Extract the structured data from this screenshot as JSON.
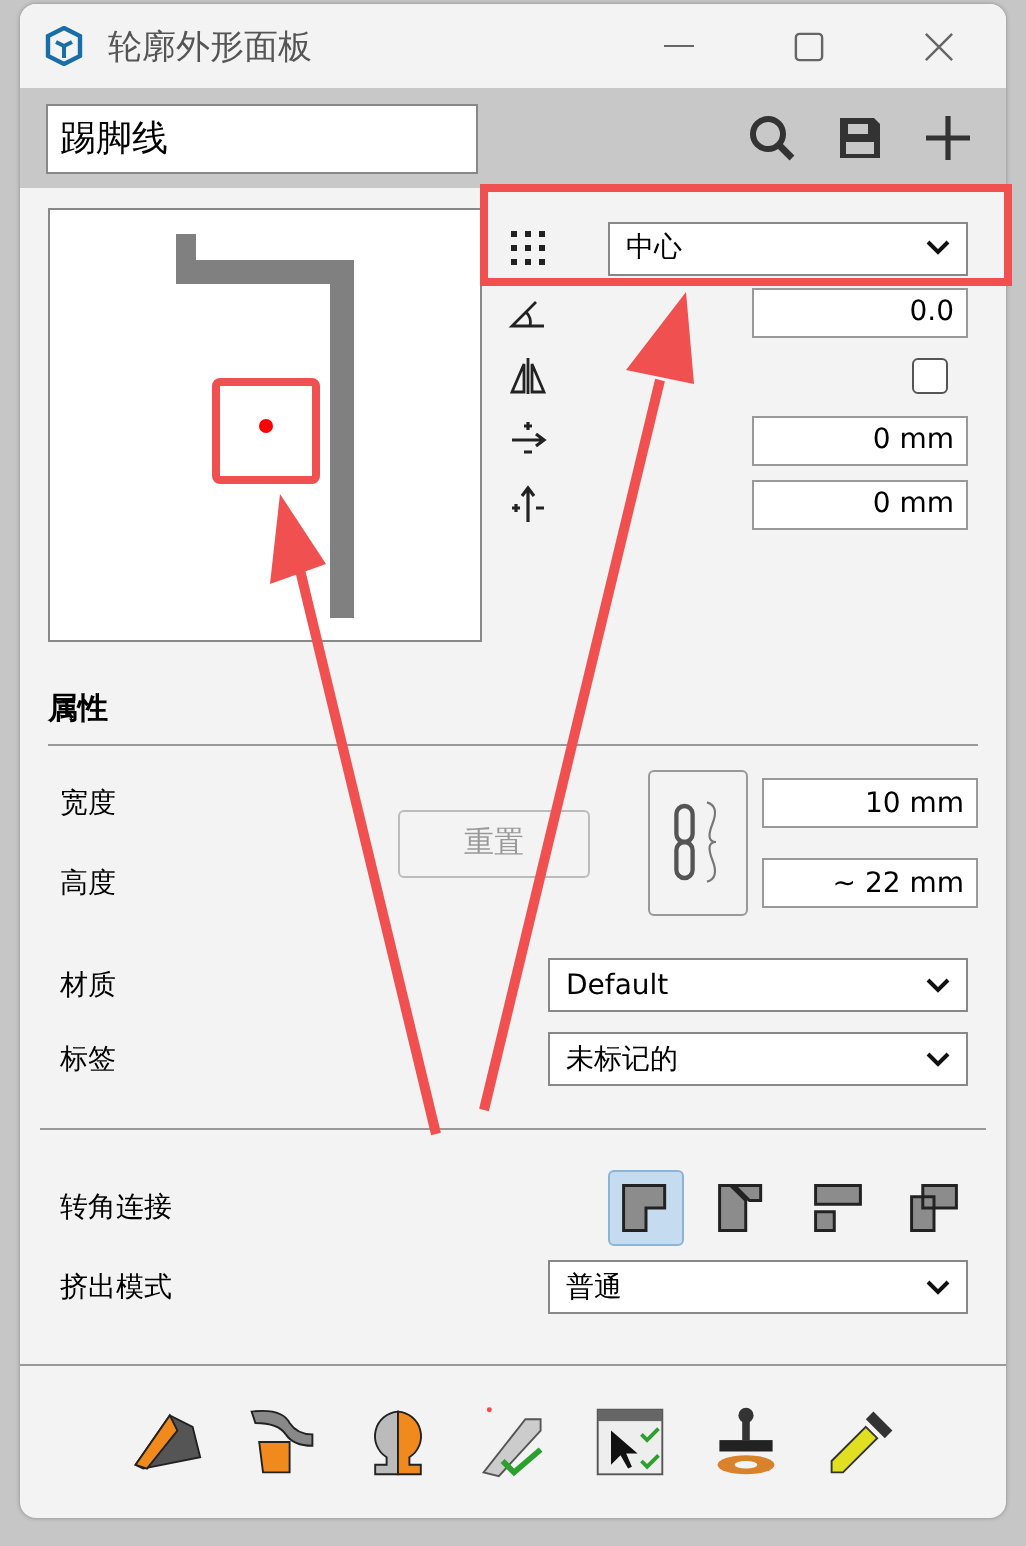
{
  "window": {
    "title": "轮廓外形面板"
  },
  "profile_name": {
    "value": "踢脚线"
  },
  "placement": {
    "alignment": "中心",
    "angle": "0.0",
    "mirror_checked": false,
    "offset_x": "0 mm",
    "offset_y": "0 mm"
  },
  "properties": {
    "heading": "属性",
    "width_label": "宽度",
    "width": "10 mm",
    "height_label": "高度",
    "height": "~ 22 mm",
    "reset_button": {
      "label": "重置",
      "disabled": true
    },
    "material_label": "材质",
    "material": "Default",
    "tag_label": "标签",
    "tag": "未标记的"
  },
  "corner_joint": {
    "label": "转角连接",
    "options": [
      {
        "kind": "square",
        "selected": true
      },
      {
        "kind": "miter",
        "selected": false
      },
      {
        "kind": "butt",
        "selected": false
      },
      {
        "kind": "overlap",
        "selected": false
      }
    ]
  },
  "extrusion": {
    "label": "挤出模式",
    "value": "普通"
  }
}
